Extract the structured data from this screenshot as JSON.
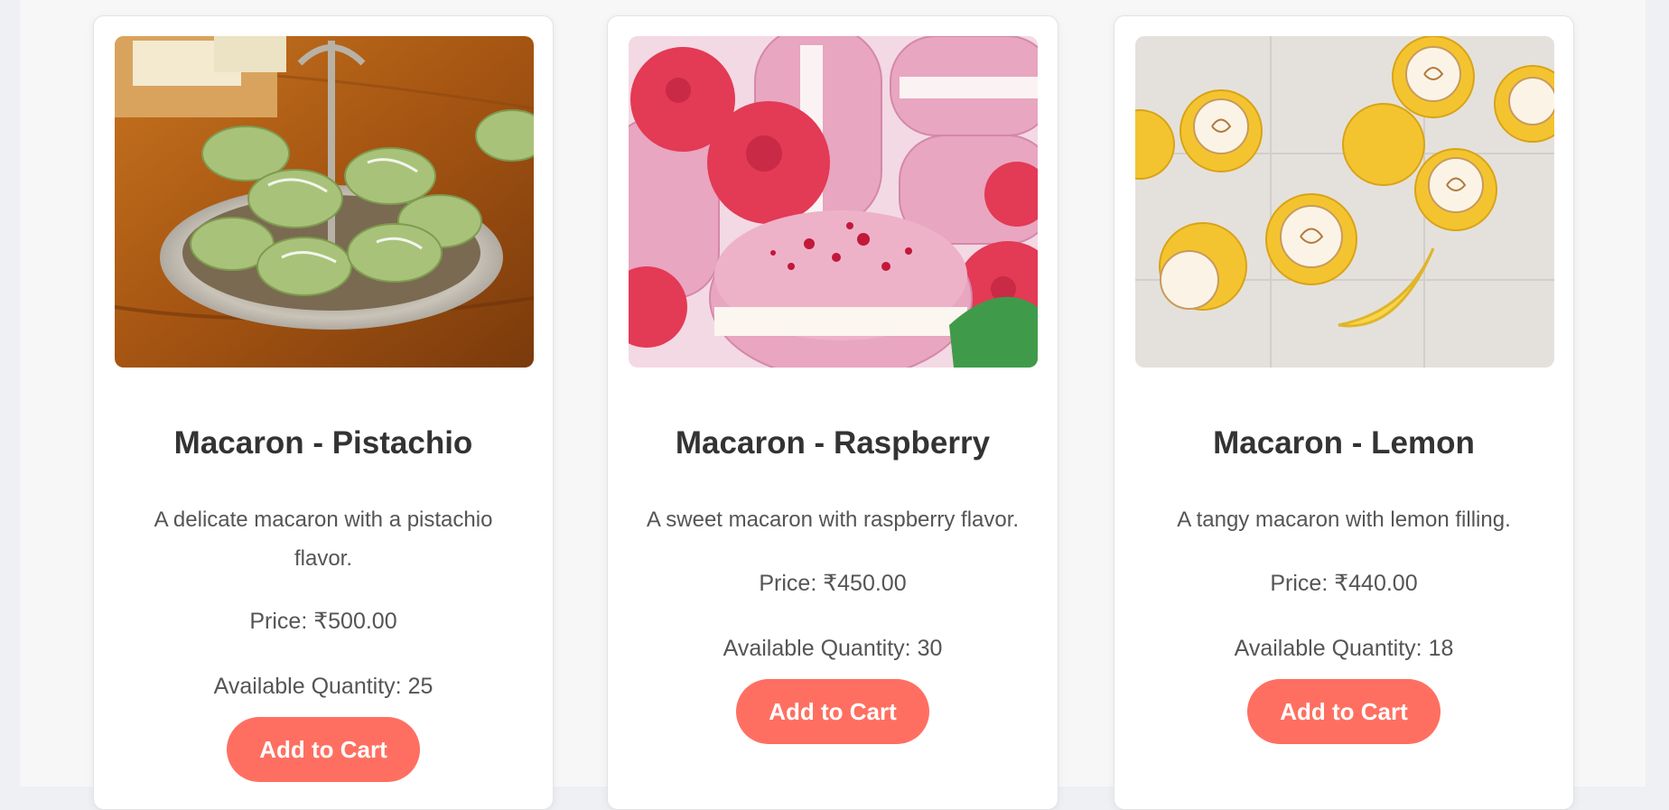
{
  "theme": {
    "accent": "#ff6f61",
    "card_background": "#ffffff",
    "page_background": "#f7f7f8"
  },
  "products": [
    {
      "image_subject": "pistachio-macarons-photo",
      "name": "Macaron - Pistachio",
      "description": "A delicate macaron with a pistachio flavor.",
      "price": "Price: ₹500.00",
      "quantity": "Available Quantity: 25",
      "button_label": "Add to Cart"
    },
    {
      "image_subject": "raspberry-macarons-photo",
      "name": "Macaron - Raspberry",
      "description": "A sweet macaron with raspberry flavor.",
      "price": "Price: ₹450.00",
      "quantity": "Available Quantity: 30",
      "button_label": "Add to Cart"
    },
    {
      "image_subject": "lemon-macarons-photo",
      "name": "Macaron - Lemon",
      "description": "A tangy macaron with lemon filling.",
      "price": "Price: ₹440.00",
      "quantity": "Available Quantity: 18",
      "button_label": "Add to Cart"
    }
  ]
}
